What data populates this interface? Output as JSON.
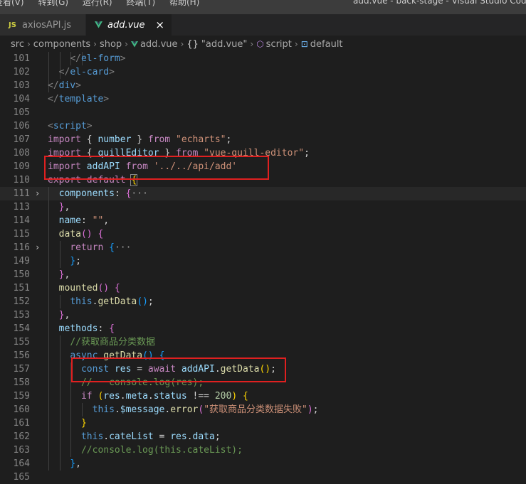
{
  "titlebar": {
    "menu": [
      "查看(V)",
      "转到(G)",
      "运行(R)",
      "终端(T)",
      "帮助(H)"
    ],
    "window_title": "add.vue - back-stage - Visual Studio Code"
  },
  "tabs": [
    {
      "icon": "js-icon",
      "icon_text": "JS",
      "label": "axiosAPI.js",
      "active": false
    },
    {
      "icon": "vue-icon",
      "label": "add.vue",
      "active": true,
      "close": "×"
    }
  ],
  "breadcrumb": {
    "items": [
      "src",
      "components",
      "shop",
      "add.vue",
      "\"add.vue\"",
      "script",
      "default"
    ],
    "braces": "{}"
  },
  "editor": {
    "lines": [
      {
        "n": "101",
        "i": 4,
        "t": [
          [
            "    ",
            "pn"
          ],
          [
            "</",
            "br"
          ],
          [
            "el-form",
            "tag"
          ],
          [
            ">",
            "br"
          ]
        ]
      },
      {
        "n": "102",
        "i": 2,
        "t": [
          [
            "  ",
            "pn"
          ],
          [
            "</",
            "br"
          ],
          [
            "el-card",
            "tag"
          ],
          [
            ">",
            "br"
          ]
        ]
      },
      {
        "n": "103",
        "i": 1,
        "t": [
          [
            "</",
            "br"
          ],
          [
            "div",
            "tag"
          ],
          [
            ">",
            "br"
          ]
        ]
      },
      {
        "n": "104",
        "i": 0,
        "t": [
          [
            "</",
            "br"
          ],
          [
            "template",
            "tag"
          ],
          [
            ">",
            "br"
          ]
        ]
      },
      {
        "n": "105",
        "i": 0,
        "t": []
      },
      {
        "n": "106",
        "i": 0,
        "t": [
          [
            "<",
            "br"
          ],
          [
            "script",
            "tag"
          ],
          [
            ">",
            "br"
          ]
        ]
      },
      {
        "n": "107",
        "i": 0,
        "t": [
          [
            "import",
            "kw"
          ],
          [
            " { ",
            "pn"
          ],
          [
            "number",
            "id"
          ],
          [
            " } ",
            "pn"
          ],
          [
            "from",
            "kw"
          ],
          [
            " ",
            "pn"
          ],
          [
            "\"echarts\"",
            "str"
          ],
          [
            ";",
            "pn"
          ]
        ]
      },
      {
        "n": "108",
        "i": 0,
        "t": [
          [
            "import",
            "kw"
          ],
          [
            " { ",
            "pn"
          ],
          [
            "quillEditor",
            "id"
          ],
          [
            " } ",
            "pn"
          ],
          [
            "from",
            "kw"
          ],
          [
            " ",
            "pn"
          ],
          [
            "\"vue-quill-editor\"",
            "str"
          ],
          [
            ";",
            "pn"
          ]
        ]
      },
      {
        "n": "109",
        "i": 0,
        "t": [
          [
            "import",
            "kw"
          ],
          [
            " ",
            "pn"
          ],
          [
            "addAPI",
            "id"
          ],
          [
            " ",
            "pn"
          ],
          [
            "from",
            "kw"
          ],
          [
            " ",
            "pn"
          ],
          [
            "'../../api/add'",
            "str"
          ]
        ]
      },
      {
        "n": "110",
        "i": 0,
        "t": [
          [
            "export",
            "kw"
          ],
          [
            " ",
            "pn"
          ],
          [
            "default",
            "kw"
          ],
          [
            " ",
            "pn"
          ],
          [
            "{",
            "y"
          ]
        ]
      },
      {
        "n": "111",
        "i": 1,
        "fold": "›",
        "hl": true,
        "t": [
          [
            "  ",
            "pn"
          ],
          [
            "components",
            "id"
          ],
          [
            ": ",
            "pn"
          ],
          [
            "{",
            "p"
          ],
          [
            "···",
            "el"
          ]
        ]
      },
      {
        "n": "113",
        "i": 1,
        "t": [
          [
            "  ",
            "pn"
          ],
          [
            "}",
            "p"
          ],
          [
            ",",
            "pn"
          ]
        ]
      },
      {
        "n": "114",
        "i": 1,
        "t": [
          [
            "  ",
            "pn"
          ],
          [
            "name",
            "id"
          ],
          [
            ": ",
            "pn"
          ],
          [
            "\"\"",
            "str"
          ],
          [
            ",",
            "pn"
          ]
        ]
      },
      {
        "n": "115",
        "i": 1,
        "t": [
          [
            "  ",
            "pn"
          ],
          [
            "data",
            "fn"
          ],
          [
            "()",
            "p"
          ],
          [
            " ",
            "pn"
          ],
          [
            "{",
            "p"
          ]
        ]
      },
      {
        "n": "116",
        "i": 2,
        "fold": "›",
        "t": [
          [
            "    ",
            "pn"
          ],
          [
            "return",
            "kw"
          ],
          [
            " ",
            "pn"
          ],
          [
            "{",
            "b"
          ],
          [
            "···",
            "el"
          ]
        ]
      },
      {
        "n": "149",
        "i": 2,
        "t": [
          [
            "    ",
            "pn"
          ],
          [
            "}",
            "b"
          ],
          [
            ";",
            "pn"
          ]
        ]
      },
      {
        "n": "150",
        "i": 1,
        "t": [
          [
            "  ",
            "pn"
          ],
          [
            "}",
            "p"
          ],
          [
            ",",
            "pn"
          ]
        ]
      },
      {
        "n": "151",
        "i": 1,
        "t": [
          [
            "  ",
            "pn"
          ],
          [
            "mounted",
            "fn"
          ],
          [
            "()",
            "p"
          ],
          [
            " ",
            "pn"
          ],
          [
            "{",
            "p"
          ]
        ]
      },
      {
        "n": "152",
        "i": 2,
        "t": [
          [
            "    ",
            "pn"
          ],
          [
            "this",
            "blue"
          ],
          [
            ".",
            "pn"
          ],
          [
            "getData",
            "fn"
          ],
          [
            "()",
            "b"
          ],
          [
            ";",
            "pn"
          ]
        ]
      },
      {
        "n": "153",
        "i": 1,
        "t": [
          [
            "  ",
            "pn"
          ],
          [
            "}",
            "p"
          ],
          [
            ",",
            "pn"
          ]
        ]
      },
      {
        "n": "154",
        "i": 1,
        "t": [
          [
            "  ",
            "pn"
          ],
          [
            "methods",
            "id"
          ],
          [
            ": ",
            "pn"
          ],
          [
            "{",
            "p"
          ]
        ]
      },
      {
        "n": "155",
        "i": 2,
        "t": [
          [
            "    ",
            "pn"
          ],
          [
            "//获取商品分类数据",
            "cm"
          ]
        ]
      },
      {
        "n": "156",
        "i": 2,
        "t": [
          [
            "    ",
            "pn"
          ],
          [
            "async",
            "blue"
          ],
          [
            " ",
            "pn"
          ],
          [
            "getData",
            "fn"
          ],
          [
            "()",
            "b"
          ],
          [
            " ",
            "pn"
          ],
          [
            "{",
            "b"
          ]
        ]
      },
      {
        "n": "157",
        "i": 3,
        "t": [
          [
            "      ",
            "pn"
          ],
          [
            "const",
            "blue"
          ],
          [
            " ",
            "pn"
          ],
          [
            "res",
            "id"
          ],
          [
            " = ",
            "pn"
          ],
          [
            "await",
            "kw"
          ],
          [
            " ",
            "pn"
          ],
          [
            "addAPI",
            "id"
          ],
          [
            ".",
            "pn"
          ],
          [
            "getData",
            "fn"
          ],
          [
            "()",
            "y"
          ],
          [
            ";",
            "pn"
          ]
        ]
      },
      {
        "n": "158",
        "i": 3,
        "t": [
          [
            "      ",
            "pn"
          ],
          [
            "//   console.log(res);",
            "cm"
          ]
        ]
      },
      {
        "n": "159",
        "i": 3,
        "t": [
          [
            "      ",
            "pn"
          ],
          [
            "if",
            "kw"
          ],
          [
            " ",
            "pn"
          ],
          [
            "(",
            "y"
          ],
          [
            "res",
            "id"
          ],
          [
            ".",
            "pn"
          ],
          [
            "meta",
            "id"
          ],
          [
            ".",
            "pn"
          ],
          [
            "status",
            "id"
          ],
          [
            " !== ",
            "pn"
          ],
          [
            "200",
            "num"
          ],
          [
            ")",
            "y"
          ],
          [
            " ",
            "pn"
          ],
          [
            "{",
            "y"
          ]
        ]
      },
      {
        "n": "160",
        "i": 4,
        "t": [
          [
            "        ",
            "pn"
          ],
          [
            "this",
            "blue"
          ],
          [
            ".",
            "pn"
          ],
          [
            "$message",
            "id"
          ],
          [
            ".",
            "pn"
          ],
          [
            "error",
            "fn"
          ],
          [
            "(",
            "p"
          ],
          [
            "\"获取商品分类数据失败\"",
            "str"
          ],
          [
            ")",
            "p"
          ],
          [
            ";",
            "pn"
          ]
        ]
      },
      {
        "n": "161",
        "i": 3,
        "t": [
          [
            "      ",
            "pn"
          ],
          [
            "}",
            "y"
          ]
        ]
      },
      {
        "n": "162",
        "i": 3,
        "t": [
          [
            "      ",
            "pn"
          ],
          [
            "this",
            "blue"
          ],
          [
            ".",
            "pn"
          ],
          [
            "cateList",
            "id"
          ],
          [
            " = ",
            "pn"
          ],
          [
            "res",
            "id"
          ],
          [
            ".",
            "pn"
          ],
          [
            "data",
            "id"
          ],
          [
            ";",
            "pn"
          ]
        ]
      },
      {
        "n": "163",
        "i": 3,
        "t": [
          [
            "      ",
            "pn"
          ],
          [
            "//console.log(this.cateList);",
            "cm"
          ]
        ]
      },
      {
        "n": "164",
        "i": 2,
        "t": [
          [
            "    ",
            "pn"
          ],
          [
            "}",
            "b"
          ],
          [
            ",",
            "pn"
          ]
        ]
      },
      {
        "n": "165",
        "i": 0,
        "t": []
      }
    ]
  },
  "colors": {
    "background": "#1e1e1e",
    "highlight_box": "#e02020",
    "keyword": "#c586c0",
    "string": "#ce9178",
    "comment": "#6a9955"
  }
}
